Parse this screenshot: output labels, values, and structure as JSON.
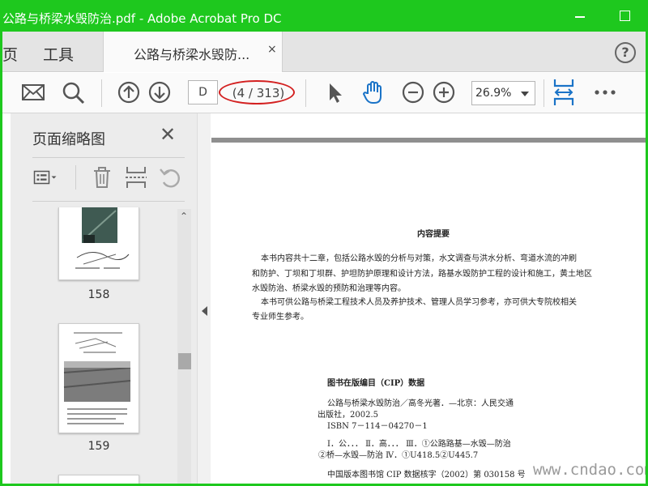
{
  "window": {
    "title": "公路与桥梁水毁防治.pdf - Adobe Acrobat Pro DC"
  },
  "tabs": {
    "home_label": "页",
    "tools_label": "工具",
    "document_tab_label": "公路与桥梁水毁防...",
    "close_glyph": "×",
    "help_glyph": "?"
  },
  "toolbar": {
    "page_input_value": "D",
    "page_count": "(4 / 313)",
    "zoom_value": "26.9%",
    "icons": [
      "mail-icon",
      "search-icon",
      "page-up-icon",
      "page-down-icon",
      "select-arrow-icon",
      "hand-tool-icon",
      "zoom-out-icon",
      "zoom-in-icon",
      "fit-width-icon",
      "more-icon"
    ]
  },
  "thumbnails_panel": {
    "title": "页面缩略图",
    "close_glyph": "✕",
    "thumbnails": [
      {
        "page_label": "158"
      },
      {
        "page_label": "159"
      }
    ]
  },
  "document": {
    "heading": "内容提要",
    "summary_lines": [
      "本书内容共十二章，包括公路水毁的分析与对策，水文调查与洪水分析、弯道水流的冲刷",
      "和防护、丁坝和丁坝群、护坦防护原理和设计方法，路基水毁防护工程的设计和施工，黄土地区",
      "水毁防治、桥梁水毁的预防和治理等内容。",
      "本书可供公路与桥梁工程技术人员及养护技术、管理人员学习参考，亦可供大专院校相关",
      "专业师生参考。"
    ],
    "cip_heading": "图书在版编目（CIP）数据",
    "cip_lines": [
      "公路与桥梁水毁防治／高冬光著．—北京：人民交通",
      "出版社，2002.5",
      "ISBN 7－114－04270－1",
      "Ⅰ．公．．．  Ⅱ．高．．．  Ⅲ．①公路路基—水毁—防治",
      "②桥—水毁—防治  Ⅳ．①U418.5②U445.7",
      "中国版本图书馆 CIP 数据核字（2002）第 030158 号"
    ]
  },
  "watermark": "www.cndao.com",
  "colors": {
    "titlebar": "#1ec81e",
    "accent_blue": "#1a73c7",
    "highlight_red": "#d32020"
  }
}
